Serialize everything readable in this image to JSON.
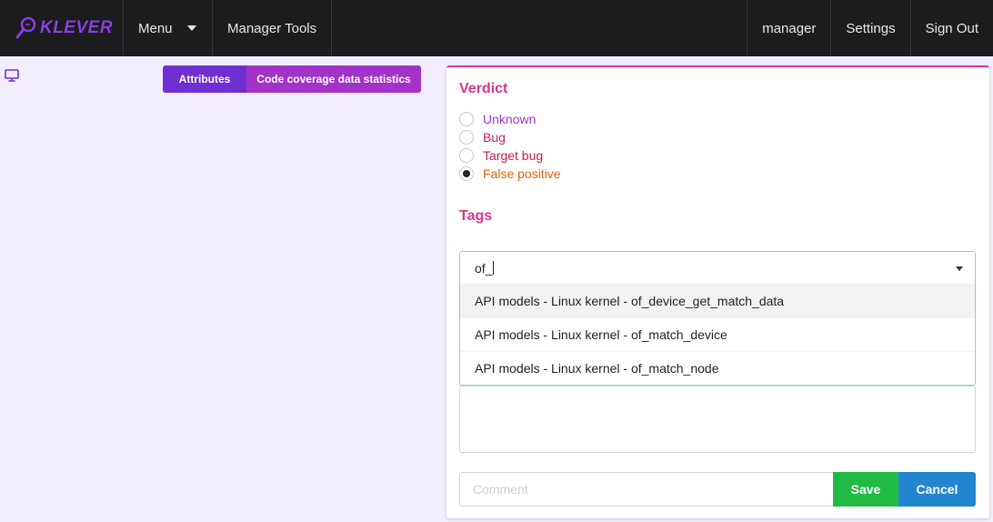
{
  "nav": {
    "logo_text": "KLEVER",
    "menu_label": "Menu",
    "manager_tools_label": "Manager Tools",
    "user_label": "manager",
    "settings_label": "Settings",
    "signout_label": "Sign Out"
  },
  "tabs": {
    "attributes_label": "Attributes",
    "coverage_label": "Code coverage data statistics"
  },
  "verdict": {
    "title": "Verdict",
    "options": [
      {
        "label": "Unknown",
        "color": "#a333c8",
        "checked": false
      },
      {
        "label": "Bug",
        "color": "#c31f6b",
        "checked": false
      },
      {
        "label": "Target bug",
        "color": "#c31f4e",
        "checked": false
      },
      {
        "label": "False positive",
        "color": "#d9660a",
        "checked": true
      }
    ]
  },
  "tags": {
    "title": "Tags",
    "search_value": "of_",
    "suggestions": [
      "API models - Linux kernel - of_device_get_match_data",
      "API models - Linux kernel - of_match_device",
      "API models - Linux kernel - of_match_node"
    ]
  },
  "comment": {
    "placeholder": "Comment"
  },
  "actions": {
    "save_label": "Save",
    "cancel_label": "Cancel"
  },
  "colors": {
    "accent_pink": "#e03997",
    "purple": "#a333c8",
    "violet": "#6f2fd1",
    "save_green": "#21ba45",
    "cancel_blue": "#2185d0"
  }
}
